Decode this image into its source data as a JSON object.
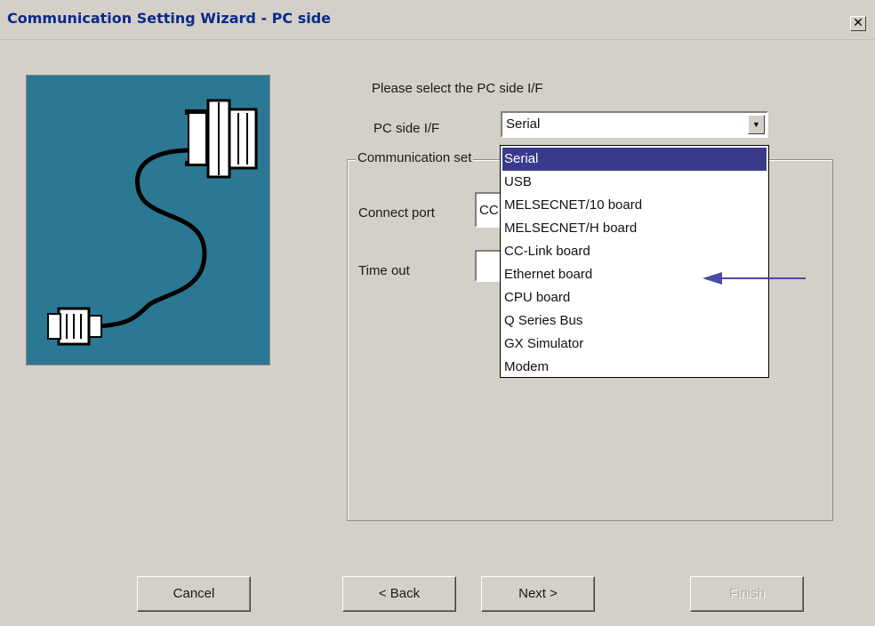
{
  "window": {
    "title": "Communication Setting Wizard - PC side",
    "close_glyph": "✕"
  },
  "main": {
    "prompt": "Please select the PC side I/F",
    "pc_side_label": "PC side I/F",
    "pc_side_value": "Serial",
    "combo_arrow": "▼",
    "group_title": "Communication set",
    "connect_port_label": "Connect port",
    "connect_port_value": "CC",
    "timeout_label": "Time out",
    "timeout_value": ""
  },
  "dropdown": {
    "options": [
      "Serial",
      "USB",
      "MELSECNET/10 board",
      "MELSECNET/H board",
      "CC-Link board",
      "Ethernet board",
      "CPU board",
      "Q Series Bus",
      "GX Simulator",
      "Modem"
    ],
    "highlighted": "Serial",
    "annotation_arrow_color": "#4a4aa0"
  },
  "buttons": {
    "cancel": "Cancel",
    "back": "< Back",
    "next": "Next >",
    "finish": "Finish"
  },
  "colors": {
    "image_bg": "#2b7893",
    "title_text": "#0a2a8a",
    "selection": "#3a3a8a"
  },
  "icons": {
    "illustration": "serial-cable-icon",
    "close": "close-icon",
    "combo": "chevron-down-icon"
  }
}
